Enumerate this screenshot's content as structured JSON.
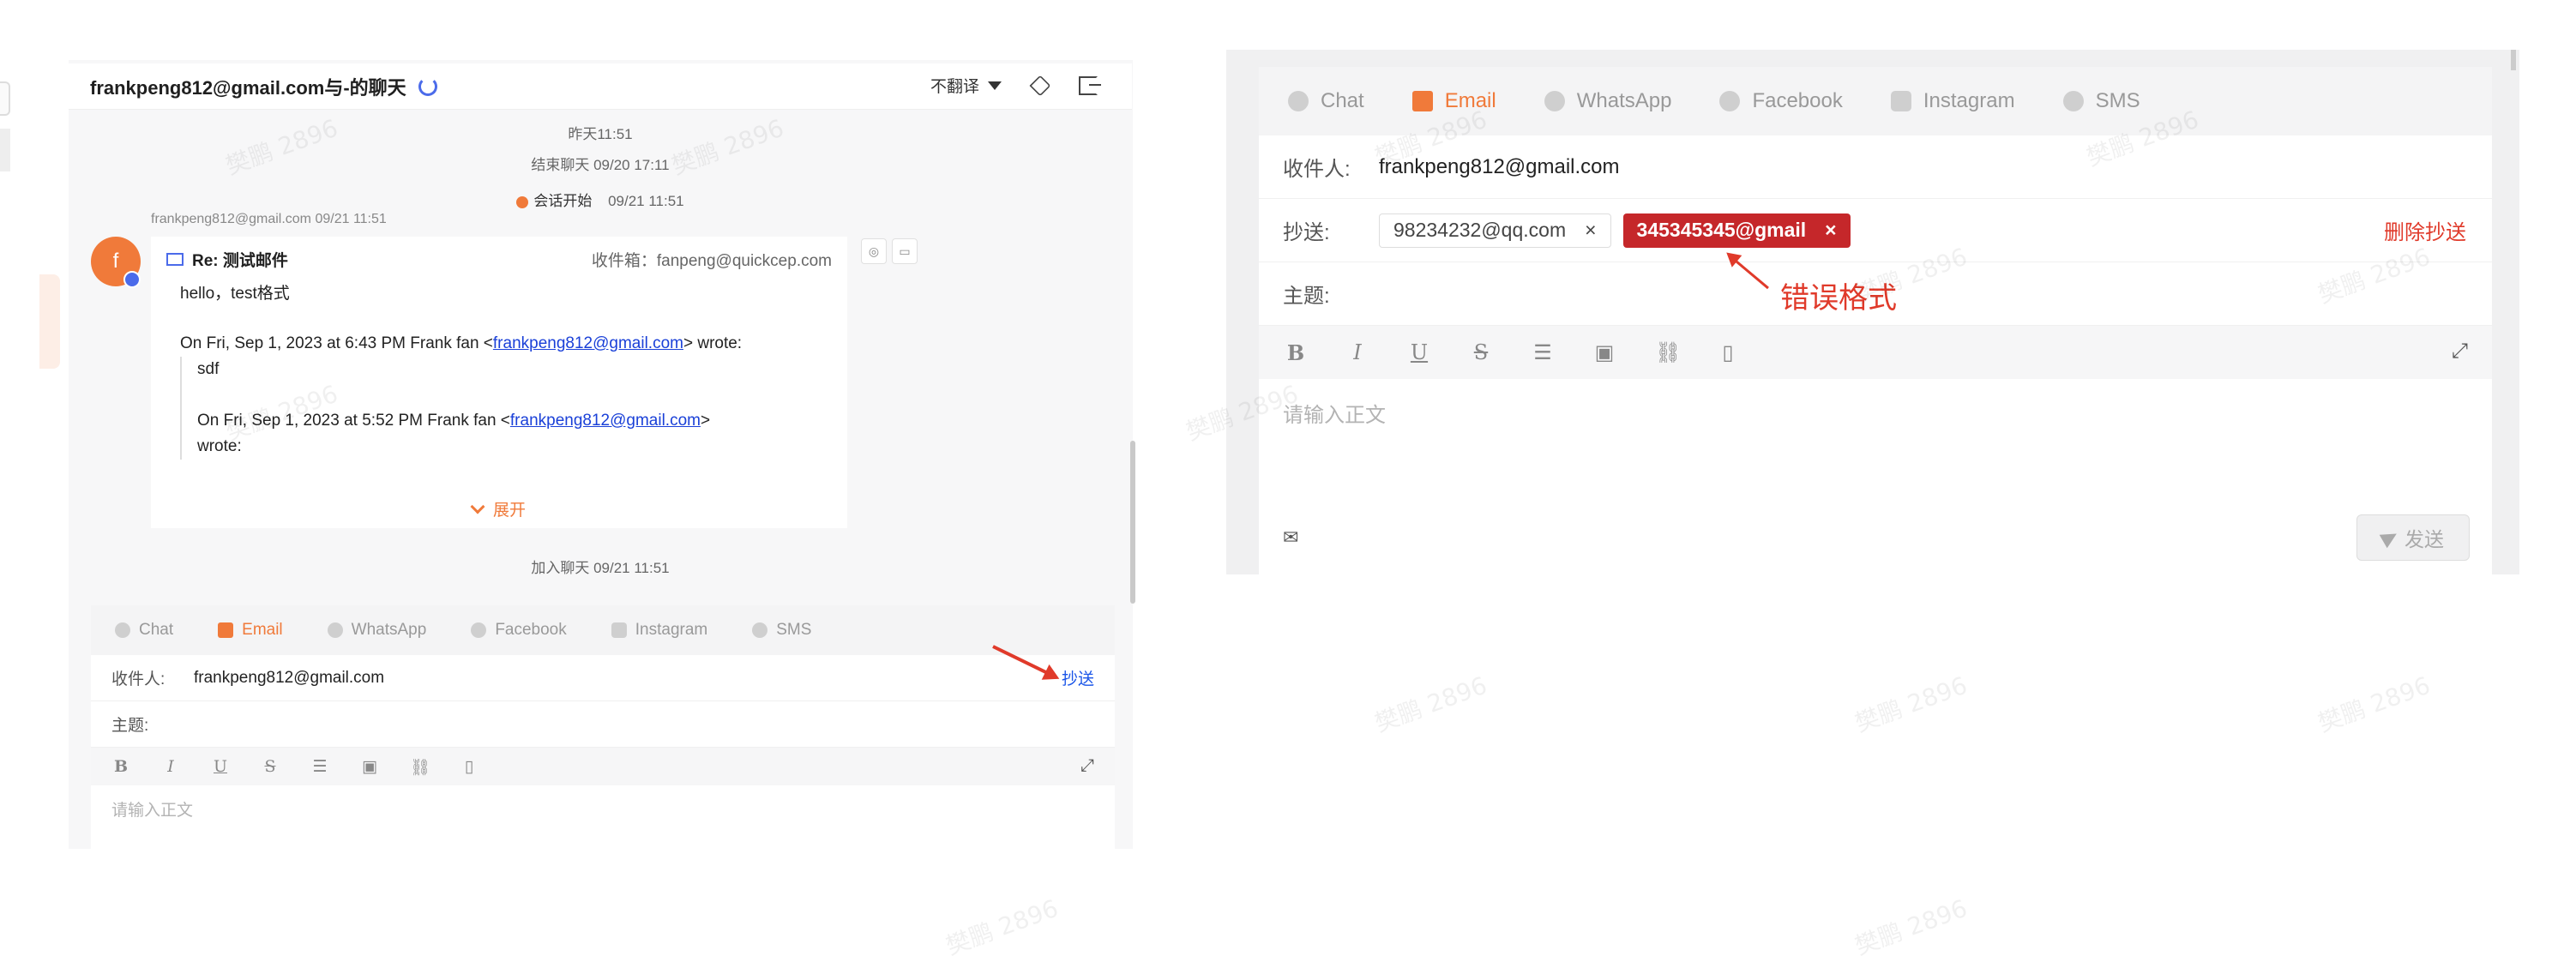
{
  "watermark": "樊鹏 2896",
  "left": {
    "header": {
      "title": "frankpeng812@gmail.com与-的聊天",
      "translate_label": "不翻译"
    },
    "timeline": {
      "yesterday": "昨天11:51",
      "end_chat": "结束聊天  09/20 17:11",
      "session_start_label": "会话开始",
      "session_start_time": "09/21 11:51",
      "sender_line": "frankpeng812@gmail.com  09/21 11:51",
      "join_chat": "加入聊天  09/21 11:51"
    },
    "avatar_letter": "f",
    "mail": {
      "subject": "Re: 测试邮件",
      "inbox": "收件箱：fanpeng@quickcep.com",
      "greeting": "hello，test格式",
      "quote1_prefix": "On Fri, Sep 1, 2023 at 6:43 PM Frank fan <",
      "quote1_link": "frankpeng812@gmail.com",
      "quote1_suffix": "> wrote:",
      "quote1_body": "sdf",
      "quote2_prefix": "On Fri, Sep 1, 2023 at 5:52 PM Frank fan <",
      "quote2_link": "frankpeng812@gmail.com",
      "quote2_suffix": ">",
      "quote2_wrote": "wrote:",
      "expand_label": "展开"
    },
    "composer": {
      "tabs": [
        "Chat",
        "Email",
        "WhatsApp",
        "Facebook",
        "Instagram",
        "SMS"
      ],
      "to_label": "收件人:",
      "to_value": "frankpeng812@gmail.com",
      "cc_link": "抄送",
      "subject_label": "主题:",
      "body_placeholder": "请输入正文"
    }
  },
  "right": {
    "composer": {
      "tabs": [
        "Chat",
        "Email",
        "WhatsApp",
        "Facebook",
        "Instagram",
        "SMS"
      ],
      "to_label": "收件人:",
      "to_value": "frankpeng812@gmail.com",
      "cc_label": "抄送:",
      "cc_chips": [
        {
          "value": "98234232@qq.com",
          "remove": "×",
          "valid": true
        },
        {
          "value": "345345345@gmail",
          "remove": "×",
          "valid": false
        }
      ],
      "delete_cc": "删除抄送",
      "subject_label": "主题:",
      "body_placeholder": "请输入正文",
      "send_label": "发送"
    },
    "annotation": "错误格式"
  },
  "toolbar_icons": [
    "bold-icon",
    "italic-icon",
    "underline-icon",
    "strikethrough-icon",
    "list-icon",
    "image-icon",
    "link-icon",
    "file-icon"
  ],
  "colors": {
    "accent": "#f07a3a",
    "link": "#1a40d8",
    "error": "#c5272a",
    "annotation": "#e03a2a"
  }
}
